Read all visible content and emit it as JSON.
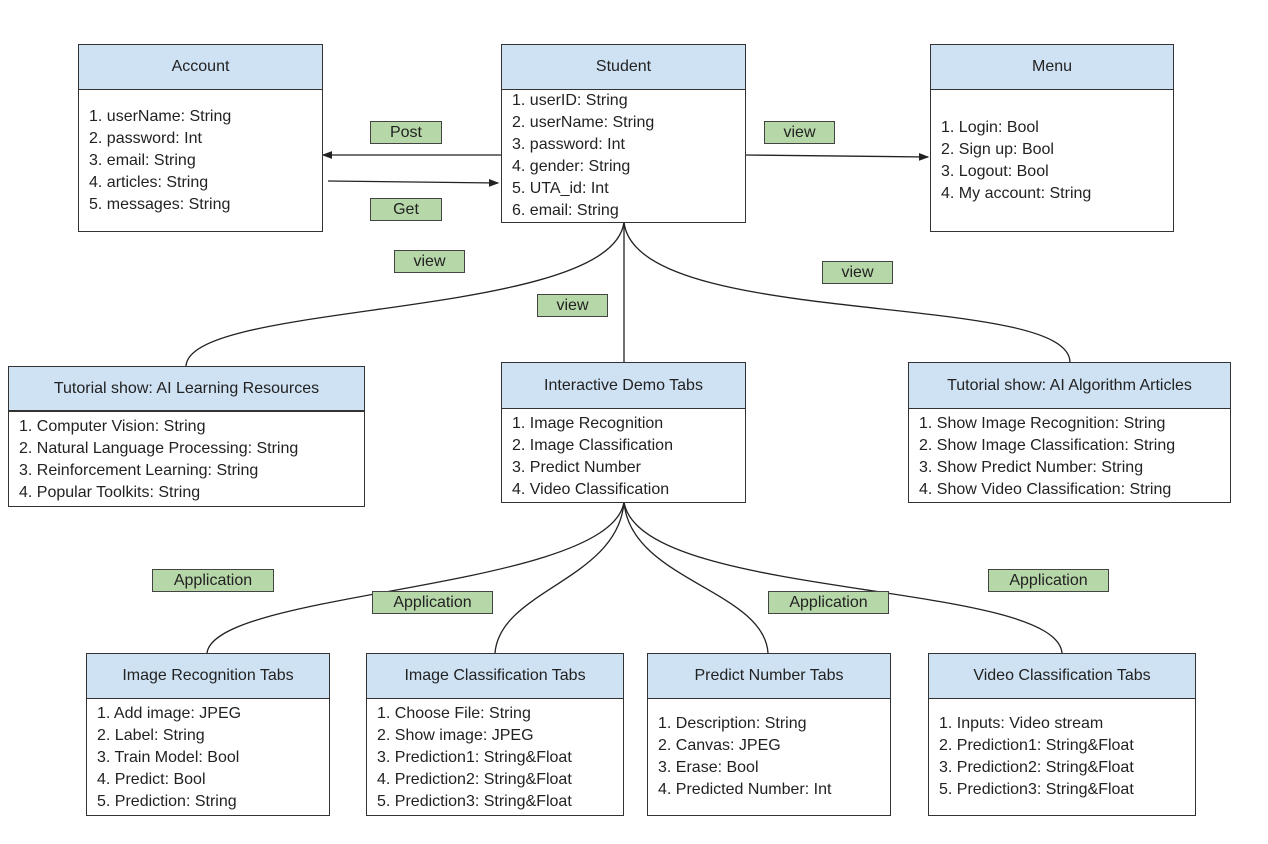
{
  "colors": {
    "header_fill": "#cfe2f3",
    "label_fill": "#b6d7a8",
    "line": "#222222"
  },
  "boxes": {
    "account": {
      "title": "Account",
      "items": [
        "1. userName: String",
        "2. password: Int",
        "3. email: String",
        "4. articles: String",
        "5. messages: String"
      ]
    },
    "student": {
      "title": "Student",
      "items": [
        "1. userID: String",
        "2. userName: String",
        "3. password: Int",
        "4. gender: String",
        "5. UTA_id: Int",
        "6. email: String"
      ]
    },
    "menu": {
      "title": "Menu",
      "items": [
        "1. Login: Bool",
        "2. Sign up: Bool",
        "3. Logout: Bool",
        "4. My account: String"
      ]
    },
    "learning": {
      "title": "Tutorial show: AI Learning Resources",
      "items": [
        "1. Computer Vision: String",
        "2. Natural Language Processing: String",
        "3. Reinforcement Learning: String",
        "4. Popular Toolkits: String"
      ]
    },
    "demo": {
      "title": "Interactive Demo Tabs",
      "items": [
        "1. Image Recognition",
        "2. Image Classification",
        "3. Predict Number",
        "4. Video Classification"
      ]
    },
    "articles": {
      "title": "Tutorial show: AI Algorithm Articles",
      "items": [
        "1. Show Image Recognition: String",
        "2. Show Image Classification: String",
        "3. Show Predict Number: String",
        "4. Show Video Classification: String"
      ]
    },
    "recognition": {
      "title": "Image Recognition  Tabs",
      "items": [
        "1. Add image: JPEG",
        "2. Label: String",
        "3. Train Model: Bool",
        "4. Predict: Bool",
        "5. Prediction: String"
      ]
    },
    "classification": {
      "title": "Image Classification Tabs",
      "items": [
        "1. Choose File: String",
        "2. Show image: JPEG",
        "3. Prediction1: String&Float",
        "4. Prediction2: String&Float",
        "5. Prediction3: String&Float"
      ]
    },
    "predict": {
      "title": "Predict Number Tabs",
      "items": [
        "1. Description: String",
        "2. Canvas: JPEG",
        "3. Erase: Bool",
        "4. Predicted Number: Int"
      ]
    },
    "video": {
      "title": "Video Classification Tabs",
      "items": [
        "1. Inputs: Video stream",
        "2. Prediction1: String&Float",
        "3. Prediction2: String&Float",
        "5. Prediction3: String&Float"
      ]
    }
  },
  "labels": {
    "post": "Post",
    "get": "Get",
    "view_menu": "view",
    "view_learning": "view",
    "view_demo": "view",
    "view_articles": "view",
    "app_recognition": "Application",
    "app_classification": "Application",
    "app_predict": "Application",
    "app_video": "Application"
  }
}
